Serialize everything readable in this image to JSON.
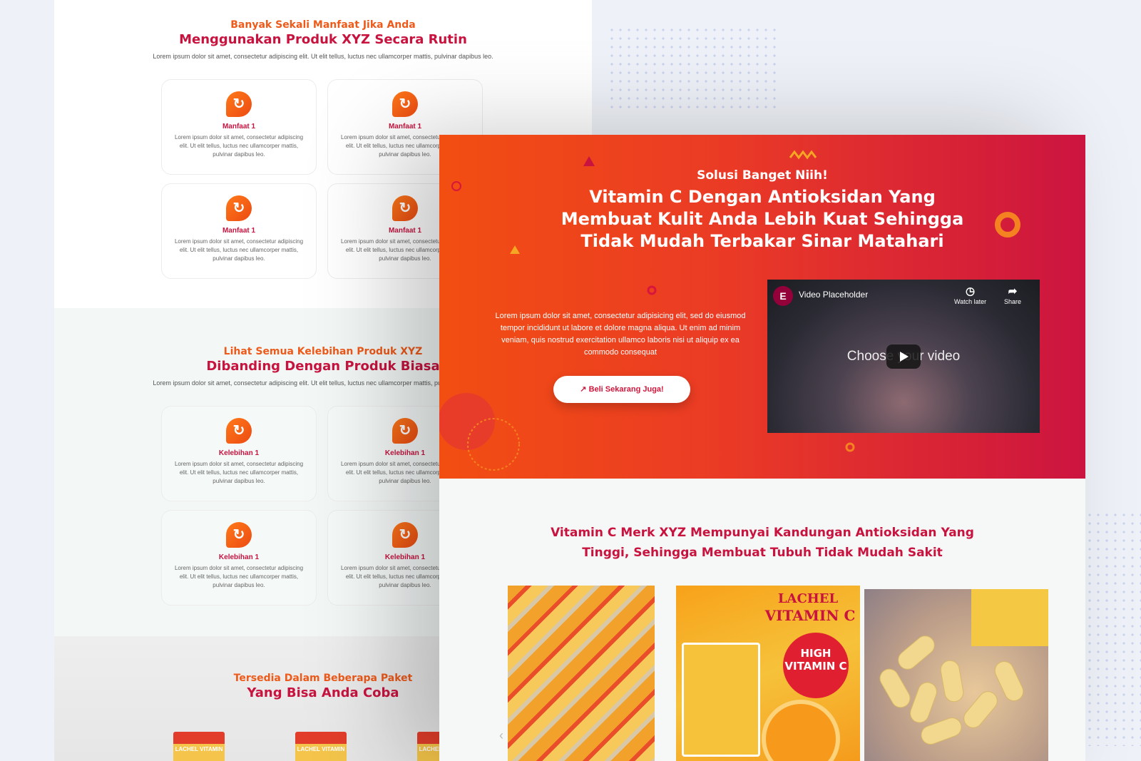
{
  "back_page": {
    "section1": {
      "kicker": "Banyak Sekali Manfaat Jika Anda",
      "title": "Menggunakan Produk XYZ Secara Rutin",
      "desc": "Lorem ipsum dolor sit amet, consectetur adipiscing elit. Ut elit tellus, luctus nec ullamcorper mattis, pulvinar dapibus leo.",
      "cards": [
        {
          "title": "Manfaat 1",
          "text": "Lorem ipsum dolor sit amet, consectetur adipiscing elit. Ut elit tellus, luctus nec ullamcorper mattis, pulvinar dapibus leo."
        },
        {
          "title": "Manfaat 1",
          "text": "Lorem ipsum dolor sit amet, consectetur adipiscing elit. Ut elit tellus, luctus nec ullamcorper mattis, pulvinar dapibus leo."
        },
        {
          "title": "Manfaat 1",
          "text": "Lorem ipsum dolor sit amet, consectetur adipiscing elit. Ut elit tellus, luctus nec ullamcorper mattis, pulvinar dapibus leo."
        },
        {
          "title": "Manfaat 1",
          "text": "Lorem ipsum dolor sit amet, consectetur adipiscing elit. Ut elit tellus, luctus nec ullamcorper mattis, pulvinar dapibus leo."
        }
      ]
    },
    "section2": {
      "kicker": "Lihat Semua Kelebihan Produk XYZ",
      "title": "Dibanding Dengan Produk Biasa",
      "desc": "Lorem ipsum dolor sit amet, consectetur adipiscing elit. Ut elit tellus, luctus nec ullamcorper mattis, pulvinar dapibus leo.",
      "cards": [
        {
          "title": "Kelebihan 1",
          "text": "Lorem ipsum dolor sit amet, consectetur adipiscing elit. Ut elit tellus, luctus nec ullamcorper mattis, pulvinar dapibus leo."
        },
        {
          "title": "Kelebihan 1",
          "text": "Lorem ipsum dolor sit amet, consectetur adipiscing elit. Ut elit tellus, luctus nec ullamcorper mattis, pulvinar dapibus leo."
        },
        {
          "title": "Kelebihan 1",
          "text": "Lorem ipsum dolor sit amet, consectetur adipiscing elit. Ut elit tellus, luctus nec ullamcorper mattis, pulvinar dapibus leo."
        },
        {
          "title": "Kelebihan 1",
          "text": "Lorem ipsum dolor sit amet, consectetur adipiscing elit. Ut elit tellus, luctus nec ullamcorper mattis, pulvinar dapibus leo."
        }
      ]
    },
    "section3": {
      "kicker": "Tersedia Dalam Beberapa Paket",
      "title": "Yang Bisa Anda Coba",
      "pack_label": "LACHEL VITAMIN"
    }
  },
  "hero": {
    "kicker": "Solusi Banget Niih!",
    "title": "Vitamin C Dengan Antioksidan Yang Membuat Kulit Anda Lebih Kuat Sehingga Tidak Mudah Terbakar Sinar Matahari",
    "paragraph": "Lorem ipsum dolor sit amet, consectetur adipisicing elit, sed do eiusmod tempor incididunt ut labore et dolore magna aliqua. Ut enim ad minim veniam, quis nostrud exercitation ullamco laboris nisi ut aliquip ex ea commodo consequat",
    "button_label": "Beli Sekarang Juga!",
    "video": {
      "title": "Video Placeholder",
      "watch_later": "Watch later",
      "share": "Share",
      "center_text": "Choose your video"
    }
  },
  "product_section": {
    "title": "Vitamin C Merk XYZ Mempunyai Kandungan Antioksidan Yang Tinggi, Sehingga Membuat Tubuh Tidak Mudah Sakit",
    "photo_texts": [
      "LACHEL",
      "VITAMIN C",
      "HIGH VITAMIN C"
    ]
  },
  "colors": {
    "orange": "#ee5a1a",
    "crimson": "#c8133f",
    "hero_start": "#f24e12",
    "hero_end": "#cc1440"
  }
}
